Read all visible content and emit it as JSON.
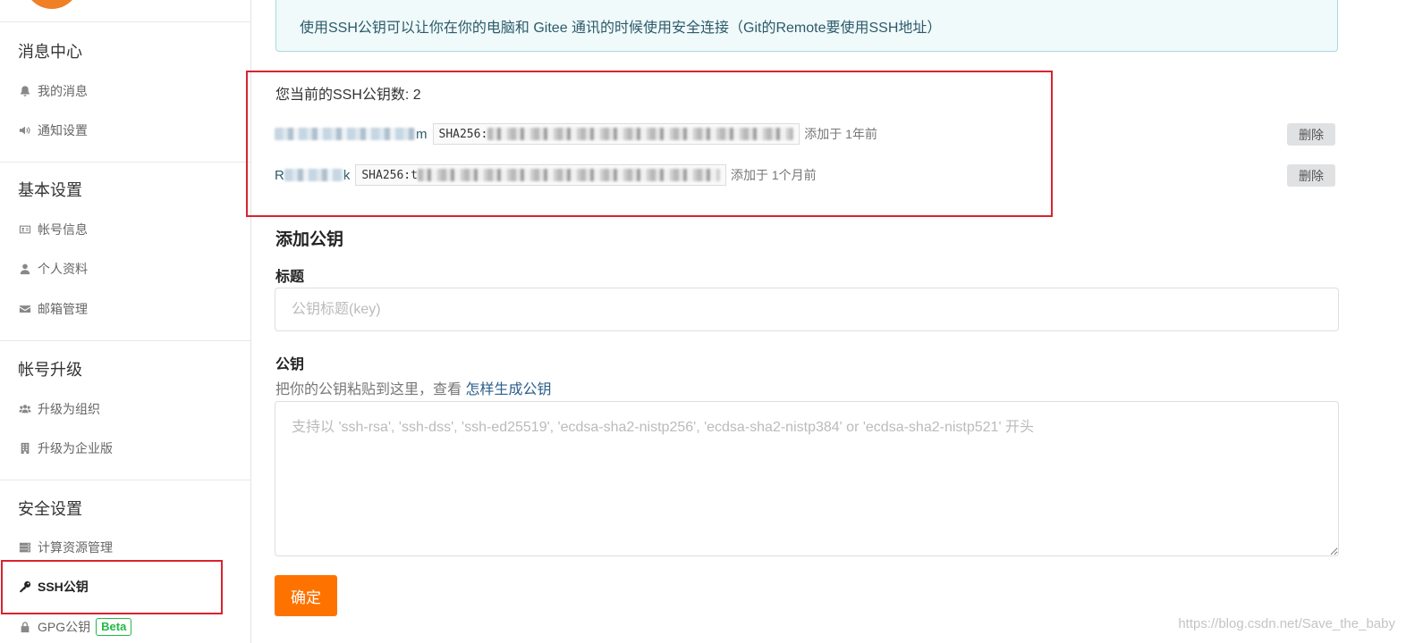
{
  "sidebar": {
    "sections": [
      {
        "heading": "消息中心",
        "items": [
          {
            "label": "我的消息",
            "icon": "bell-icon"
          },
          {
            "label": "通知设置",
            "icon": "speaker-icon"
          }
        ]
      },
      {
        "heading": "基本设置",
        "items": [
          {
            "label": "帐号信息",
            "icon": "id-card-icon"
          },
          {
            "label": "个人资料",
            "icon": "user-icon"
          },
          {
            "label": "邮箱管理",
            "icon": "envelope-icon"
          }
        ]
      },
      {
        "heading": "帐号升级",
        "items": [
          {
            "label": "升级为组织",
            "icon": "users-icon"
          },
          {
            "label": "升级为企业版",
            "icon": "building-icon"
          }
        ]
      },
      {
        "heading": "安全设置",
        "items": [
          {
            "label": "计算资源管理",
            "icon": "server-icon"
          },
          {
            "label": "SSH公钥",
            "icon": "key-icon",
            "active": true
          },
          {
            "label": "GPG公钥",
            "icon": "lock-icon",
            "badge": "Beta"
          }
        ]
      }
    ]
  },
  "notice": "使用SSH公钥可以让你在你的电脑和 Gitee 通讯的时候使用安全连接（Git的Remote要使用SSH地址）",
  "keys": {
    "count_text": "您当前的SSH公钥数: 2",
    "list": [
      {
        "name_suffix": "m",
        "fingerprint_prefix": "SHA256:",
        "added": "添加于 1年前",
        "delete_label": "删除"
      },
      {
        "name_prefix": "R",
        "name_suffix": "k",
        "fingerprint_prefix": "SHA256:t",
        "added": "添加于 1个月前",
        "delete_label": "删除"
      }
    ]
  },
  "form": {
    "heading": "添加公钥",
    "title_label": "标题",
    "title_placeholder": "公钥标题(key)",
    "key_label": "公钥",
    "help_text": "把你的公钥粘贴到这里，查看 ",
    "help_link": "怎样生成公钥",
    "key_placeholder": "支持以 'ssh-rsa', 'ssh-dss', 'ssh-ed25519', 'ecdsa-sha2-nistp256', 'ecdsa-sha2-nistp384' or 'ecdsa-sha2-nistp521' 开头",
    "submit_label": "确定"
  },
  "watermark": "https://blog.csdn.net/Save_the_baby",
  "colors": {
    "accent": "#fe7300",
    "highlight_border": "#d9232e",
    "beta": "#21ba45",
    "link": "#2a5d8a"
  }
}
